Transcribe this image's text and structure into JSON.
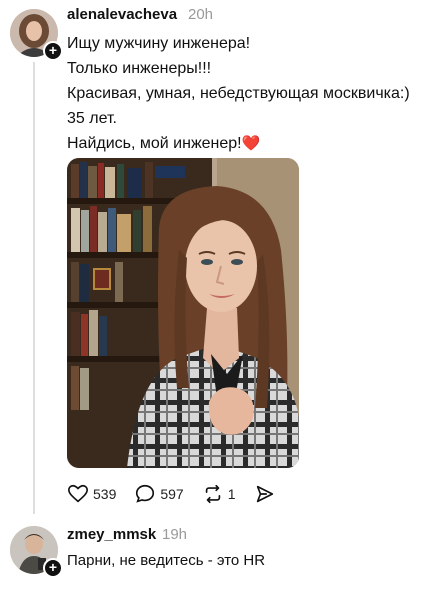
{
  "post": {
    "username": "alenalevacheva",
    "time": "20h",
    "lines": [
      "Ищу мужчину инженера!",
      "Только инженеры!!!",
      "Красивая, умная, небедствующая москвичка:)",
      "35 лет.",
      "Найдись, мой инженер!"
    ],
    "heart_emoji": "❤️"
  },
  "actions": {
    "likes": "539",
    "comments": "597",
    "reposts": "1"
  },
  "reply": {
    "username": "zmey_mmsk",
    "time": "19h",
    "text": "Парни, не ведитесь - это HR"
  },
  "icons": {
    "like": "heart-outline-icon",
    "comment": "comment-bubble-icon",
    "repost": "repost-icon",
    "share": "send-icon",
    "follow": "plus-icon"
  },
  "colors": {
    "text": "#111111",
    "muted": "#9a9a9a",
    "heart": "#e0245e",
    "thread_line": "#dedede"
  }
}
